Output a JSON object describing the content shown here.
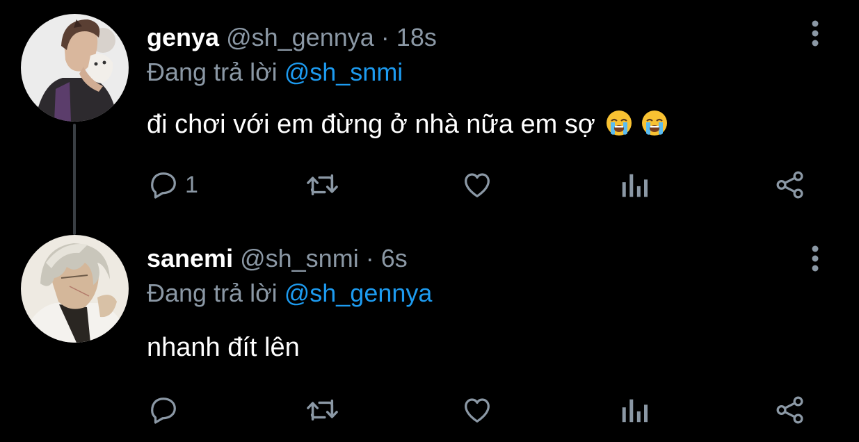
{
  "tweets": [
    {
      "display_name": "genya",
      "handle": "@sh_gennya",
      "separator": "·",
      "time": "18s",
      "replying_prefix": "Đang trả lời",
      "replying_to": "@sh_snmi",
      "text": "đi chơi với em đừng ở nhà nữa em sợ",
      "emojis": [
        "loudly-crying-face",
        "loudly-crying-face"
      ],
      "reply_count": "1",
      "avatar": "avatar-genya"
    },
    {
      "display_name": "sanemi",
      "handle": "@sh_snmi",
      "separator": "·",
      "time": "6s",
      "replying_prefix": "Đang trả lời",
      "replying_to": "@sh_gennya",
      "text": "nhanh đít lên",
      "reply_count": "",
      "avatar": "avatar-sanemi"
    }
  ],
  "icons": {
    "reply": "reply-icon",
    "retweet": "retweet-icon",
    "like": "heart-icon",
    "stats": "analytics-icon",
    "share": "share-icon",
    "more": "more-vertical-icon"
  },
  "colors": {
    "background": "#000000",
    "text": "#ffffff",
    "secondary": "#8b98a5",
    "mention": "#1d9bf0",
    "thread_line": "#3a3f44"
  }
}
